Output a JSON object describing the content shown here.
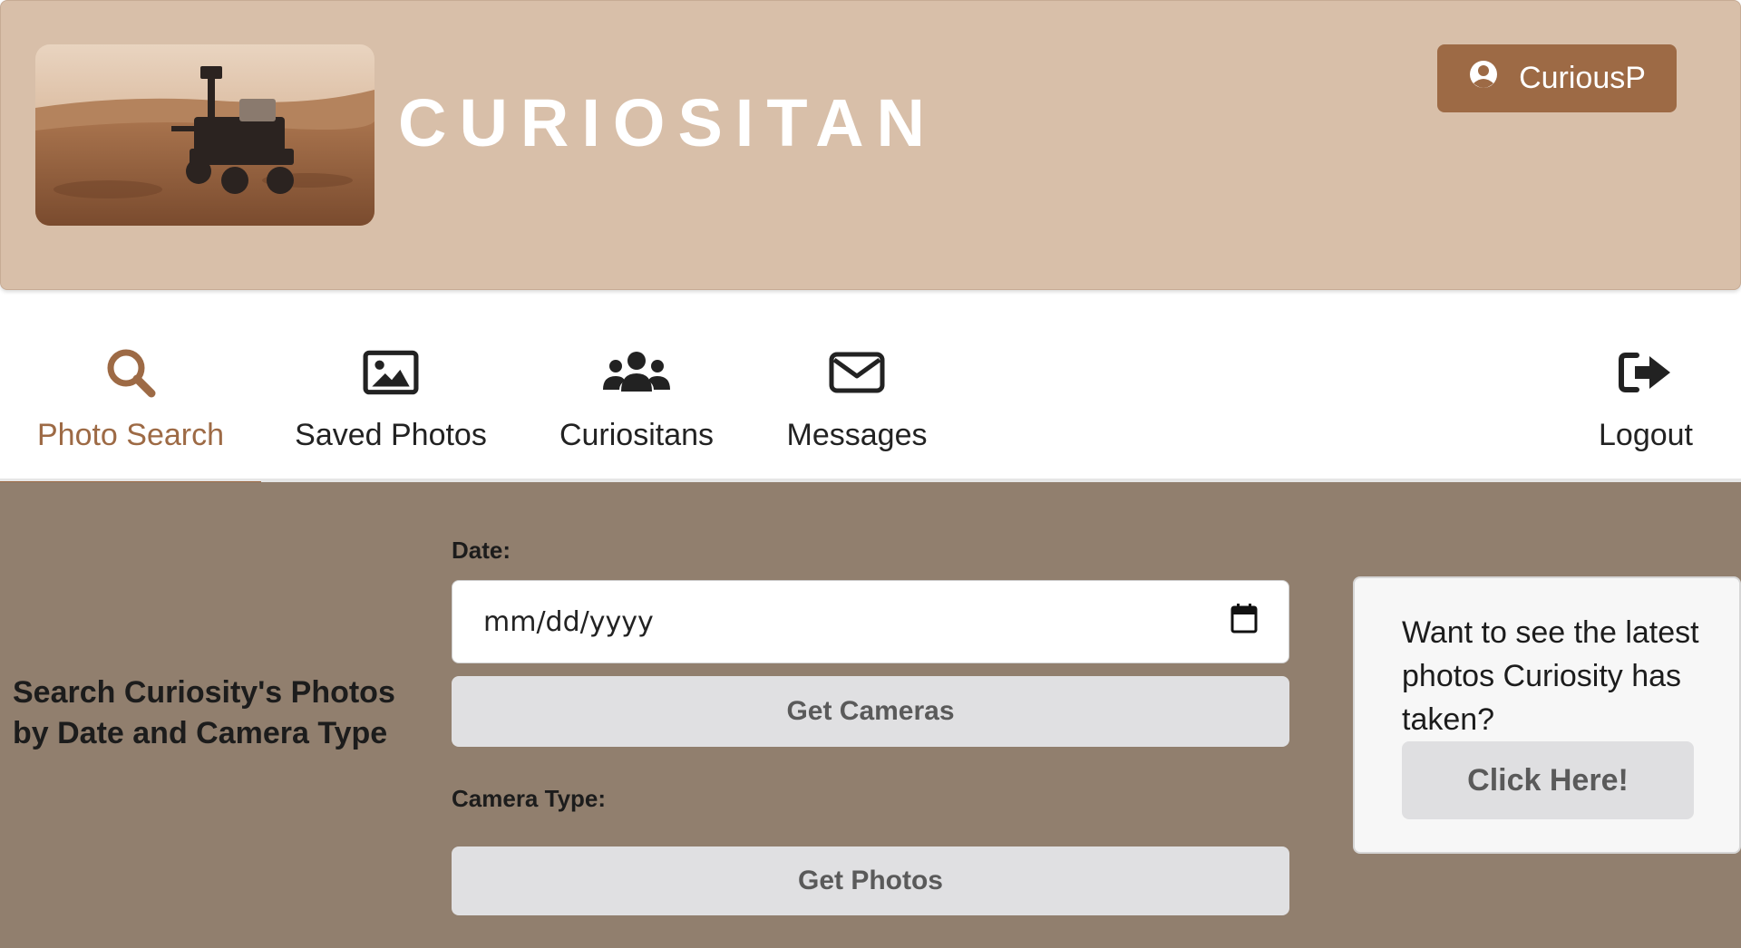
{
  "header": {
    "brand": "CURIOSITAN",
    "user_button_label": "CuriousP"
  },
  "nav": {
    "items": [
      {
        "label": "Photo Search",
        "icon": "search-icon",
        "active": true
      },
      {
        "label": "Saved Photos",
        "icon": "image-icon",
        "active": false
      },
      {
        "label": "Curiositans",
        "icon": "users-icon",
        "active": false
      },
      {
        "label": "Messages",
        "icon": "envelope-icon",
        "active": false
      },
      {
        "label": "Logout",
        "icon": "logout-icon",
        "active": false
      }
    ]
  },
  "search": {
    "title": "Search Curiosity's Photos by Date and Camera Type",
    "date_label": "Date:",
    "date_placeholder": "mm/dd/yyyy",
    "get_cameras_label": "Get Cameras",
    "camera_type_label": "Camera Type:",
    "get_photos_label": "Get Photos"
  },
  "promo": {
    "text": "Want to see the latest photos Curiosity has taken?",
    "button_label": "Click Here!"
  },
  "colors": {
    "header_bg": "#d8bfa9",
    "accent": "#9d6a45",
    "main_bg": "#917f6e"
  }
}
